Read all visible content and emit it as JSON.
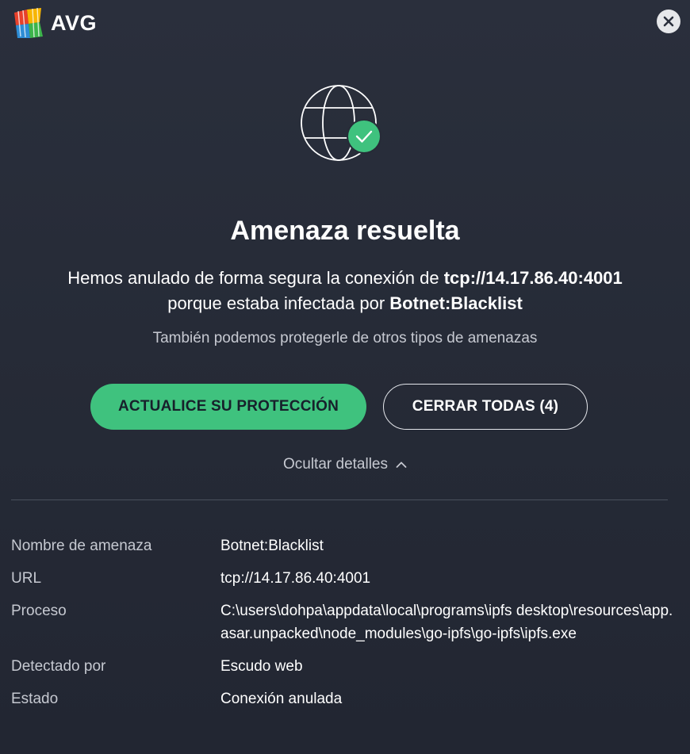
{
  "app": {
    "brand": "AVG"
  },
  "dialog": {
    "title": "Amenaza resuelta",
    "message_part1": "Hemos anulado de forma segura la conexión de ",
    "message_connection": "tcp://14.17.86.40:4001",
    "message_part2": "porque estaba infectada por ",
    "message_threat": "Botnet:Blacklist",
    "subtitle": "También podemos protegerle de otros tipos de amenazas"
  },
  "buttons": {
    "primary_label": "ACTUALICE SU PROTECCIÓN",
    "secondary_label": "CERRAR TODAS (4)",
    "toggle_details_label": "Ocultar detalles"
  },
  "details": [
    {
      "label": "Nombre de amenaza",
      "value": "Botnet:Blacklist"
    },
    {
      "label": "URL",
      "value": "tcp://14.17.86.40:4001"
    },
    {
      "label": "Proceso",
      "value": "C:\\users\\dohpa\\appdata\\local\\programs\\ipfs desktop\\resources\\app.asar.unpacked\\node_modules\\go-ipfs\\go-ipfs\\ipfs.exe"
    },
    {
      "label": "Detectado por",
      "value": "Escudo web"
    },
    {
      "label": "Estado",
      "value": "Conexión anulada"
    }
  ],
  "icons": {
    "logo": "avg-logo-icon",
    "close": "close-icon",
    "hero": "globe-check-icon",
    "toggle": "chevron-up-icon"
  },
  "colors": {
    "accent_green": "#3fc27e",
    "background": "#262b37"
  }
}
